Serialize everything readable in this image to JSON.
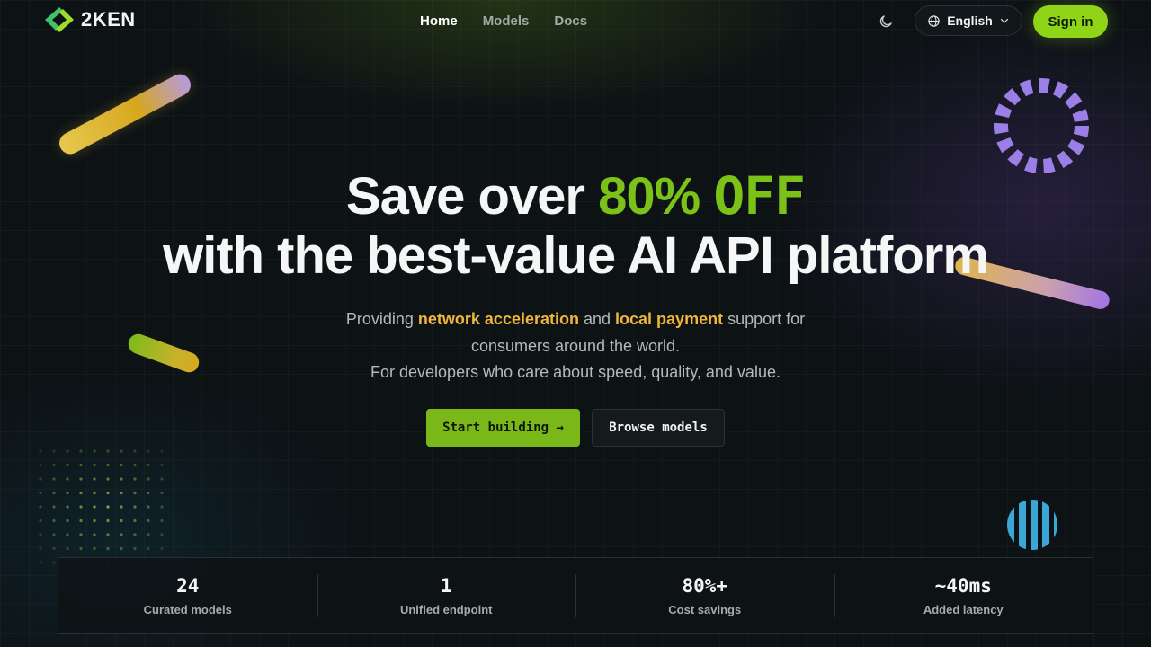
{
  "header": {
    "logo_text": "2KEN",
    "nav": [
      {
        "label": "Home",
        "active": true
      },
      {
        "label": "Models",
        "active": false
      },
      {
        "label": "Docs",
        "active": false
      }
    ],
    "theme_icon": "moon-icon",
    "language_icon": "globe-icon",
    "language_label": "English",
    "signin_label": "Sign in"
  },
  "hero": {
    "title_line1_prefix": "Save over ",
    "title_line1_accent": "80%",
    "title_line1_accent_suffix": "OFF",
    "title_line2": "with the best-value AI API platform",
    "sub_part1": "Providing ",
    "sub_hl1": "network acceleration",
    "sub_part2": " and ",
    "sub_hl2": "local payment",
    "sub_part3": " support for consumers around the world.",
    "sub_line2": "For developers who care about speed, quality, and value.",
    "cta_primary": "Start building →",
    "cta_secondary": "Browse models"
  },
  "stats": [
    {
      "value": "24",
      "label": "Curated models"
    },
    {
      "value": "1",
      "label": "Unified endpoint"
    },
    {
      "value": "80%+",
      "label": "Cost savings"
    },
    {
      "value": "~40ms",
      "label": "Added latency"
    }
  ],
  "colors": {
    "accent_green": "#7cc118",
    "button_green": "#8fd417",
    "highlight_orange": "#f0b53a",
    "background": "#0d1215"
  }
}
